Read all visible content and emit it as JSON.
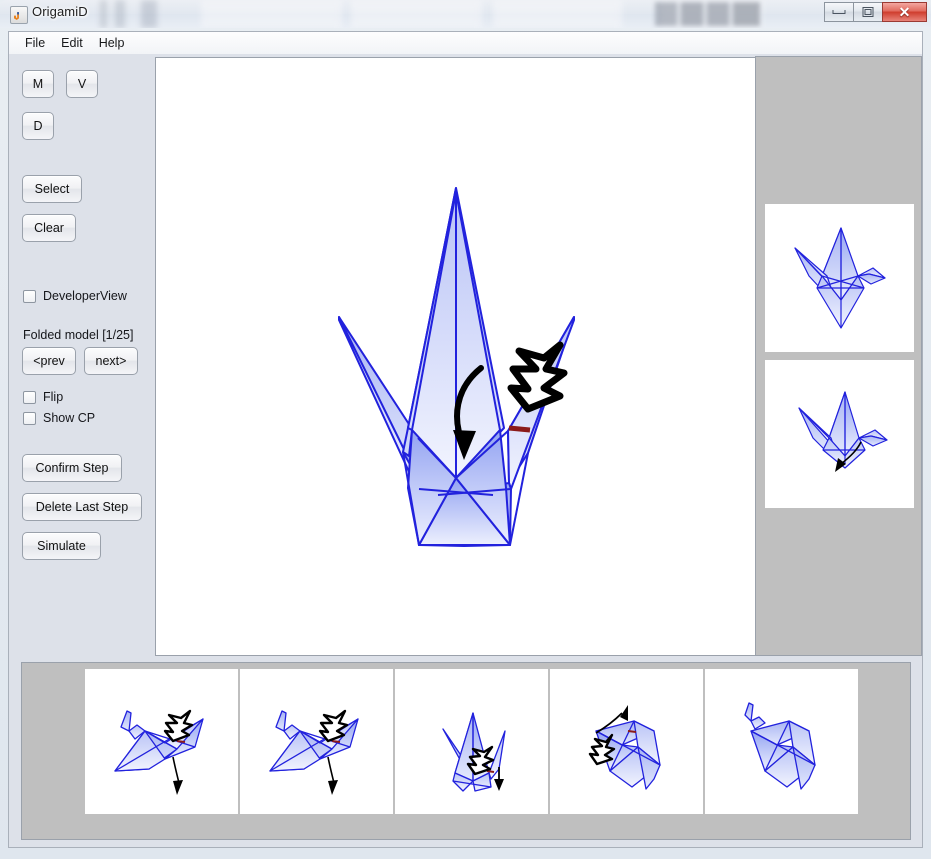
{
  "window": {
    "title": "OrigamiD",
    "icon": "java-coffee-cup-icon",
    "controls": {
      "minimize": "minimize-icon",
      "maximize": "maximize-icon",
      "close": "close-icon"
    }
  },
  "menubar": {
    "items": [
      {
        "label": "File"
      },
      {
        "label": "Edit"
      },
      {
        "label": "Help"
      }
    ]
  },
  "sidebar": {
    "crease_buttons": [
      {
        "label": "M",
        "name": "mountain-fold-button"
      },
      {
        "label": "V",
        "name": "valley-fold-button"
      },
      {
        "label": "D",
        "name": "diagonal-fold-button"
      }
    ],
    "select_button": "Select",
    "clear_button": "Clear",
    "developer_view": {
      "label": "DeveloperView",
      "checked": false
    },
    "folded_model_label": "Folded model [1/25]",
    "prev_button": "<prev",
    "next_button": "next>",
    "flip": {
      "label": "Flip",
      "checked": false
    },
    "show_cp": {
      "label": "Show CP",
      "checked": false
    },
    "confirm_step_button": "Confirm Step",
    "delete_last_step_button": "Delete Last Step",
    "simulate_button": "Simulate"
  },
  "canvas": {
    "name": "folded-model-canvas",
    "model": "origami-crane-3d",
    "background": "#ffffff",
    "paper_fill_top": "#aab6f5",
    "paper_fill_bottom": "#e8ecfd",
    "crease_color": "#2222dd",
    "highlight_color": "#8b1a1a",
    "annotation_color": "#000000"
  },
  "right_panel": {
    "name": "preview-panel",
    "background": "#bfbfbf",
    "thumbnails": [
      {
        "name": "preview-thumbnail-result",
        "caption": ""
      },
      {
        "name": "preview-thumbnail-step",
        "caption": ""
      }
    ]
  },
  "filmstrip": {
    "name": "step-filmstrip",
    "background": "#bfbfbf",
    "thumbnails": [
      {
        "name": "step-thumbnail-1"
      },
      {
        "name": "step-thumbnail-2"
      },
      {
        "name": "step-thumbnail-3"
      },
      {
        "name": "step-thumbnail-4"
      },
      {
        "name": "step-thumbnail-5"
      }
    ]
  }
}
